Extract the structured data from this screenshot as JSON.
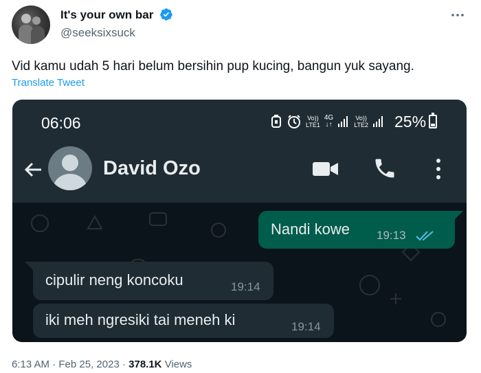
{
  "tweet": {
    "display_name": "It's your own bar",
    "handle": "@seeksixsuck",
    "text": "Vid kamu udah 5 hari belum bersihin pup kucing, bangun yuk sayang.",
    "translate_label": "Translate Tweet",
    "time": "6:13 AM",
    "date": "Feb 25, 2023",
    "views_count": "378.1K",
    "views_label": "Views",
    "separator": "·",
    "accent_color": "#1d9bf0"
  },
  "phone": {
    "status_time": "06:06",
    "battery_pct": "25%",
    "signal_labels": [
      "Vo)) LTE1",
      "4G",
      "Vo)) LTE2"
    ],
    "contact_name": "David Ozo",
    "messages": [
      {
        "direction": "outgoing",
        "text": "Nandi kowe",
        "time": "19:13",
        "read": true
      },
      {
        "direction": "incoming",
        "text": "cipulir neng koncoku",
        "time": "19:14"
      },
      {
        "direction": "incoming",
        "text": "iki meh ngresiki tai meneh ki",
        "time": "19:14"
      }
    ],
    "colors": {
      "header": "#1f2c34",
      "chat_bg": "#0b141a",
      "outgoing_bubble": "#005c4b",
      "incoming_bubble": "#1f2c34",
      "read_ticks": "#53bdeb"
    }
  }
}
